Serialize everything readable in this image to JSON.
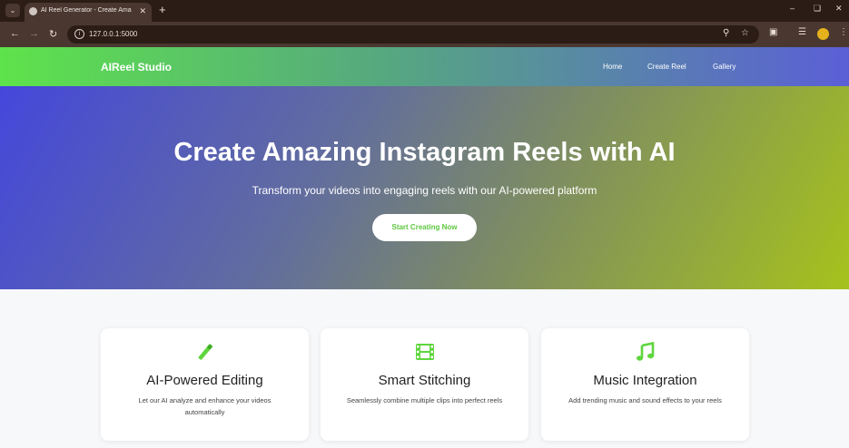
{
  "browser": {
    "tab_title": "AI Reel Generator - Create Ama...",
    "url": "127.0.0.1:5000"
  },
  "nav": {
    "brand": "AIReel Studio",
    "links": [
      "Home",
      "Create Reel",
      "Gallery"
    ]
  },
  "hero": {
    "title": "Create Amazing Instagram Reels with AI",
    "subtitle": "Transform your videos into engaging reels with our AI-powered platform",
    "cta": "Start Creating Now"
  },
  "features": [
    {
      "icon": "magic-wand-icon",
      "title": "AI-Powered Editing",
      "description": "Let our AI analyze and enhance your videos automatically"
    },
    {
      "icon": "film-icon",
      "title": "Smart Stitching",
      "description": "Seamlessly combine multiple clips into perfect reels"
    },
    {
      "icon": "music-note-icon",
      "title": "Music Integration",
      "description": "Add trending music and sound effects to your reels"
    }
  ],
  "colors": {
    "accent_green": "#5ed63d",
    "nav_gradient_start": "#5ee34b",
    "nav_gradient_end": "#5b5fd6",
    "hero_gradient_start": "#4447db",
    "hero_gradient_end": "#a6c21c"
  }
}
